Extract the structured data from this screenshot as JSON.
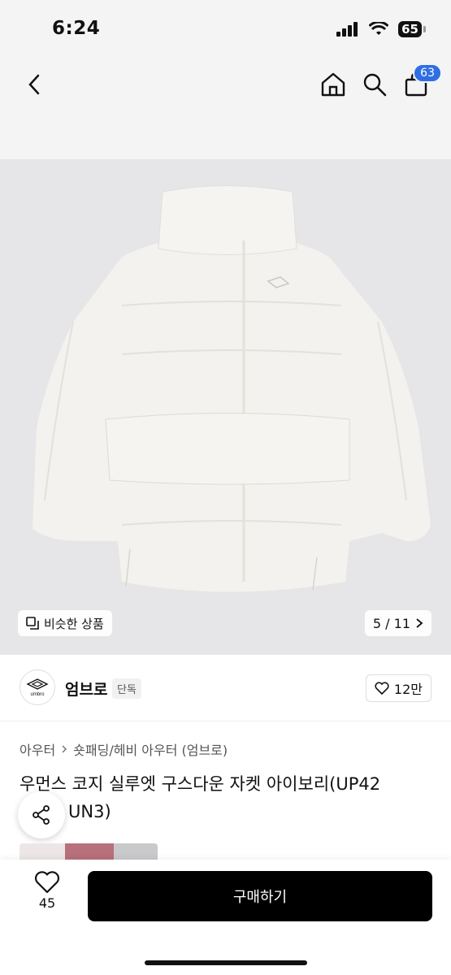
{
  "status_bar": {
    "time": "6:24",
    "battery": "65"
  },
  "nav": {
    "cart_count": "63"
  },
  "gallery": {
    "similar_label": "비슷한 상품",
    "page_counter": "5 / 11"
  },
  "brand": {
    "logo_text": "umbro",
    "name": "엄브로",
    "badge": "단독"
  },
  "likes": {
    "count": "12만"
  },
  "breadcrumb": {
    "items": [
      "아우터",
      "숏패딩/헤비 아우터 (엄브로)"
    ]
  },
  "product": {
    "title_line1": "우먼스 코지 실루엣 구스다운 자켓 아이보리(UP42",
    "title_line2": "UN3)"
  },
  "bottom": {
    "wish_count": "45",
    "buy_label": "구매하기"
  },
  "colors": {
    "accent_badge": "#2f6fe4",
    "buy_button": "#000000",
    "image_bg": "#e6e6e8"
  }
}
